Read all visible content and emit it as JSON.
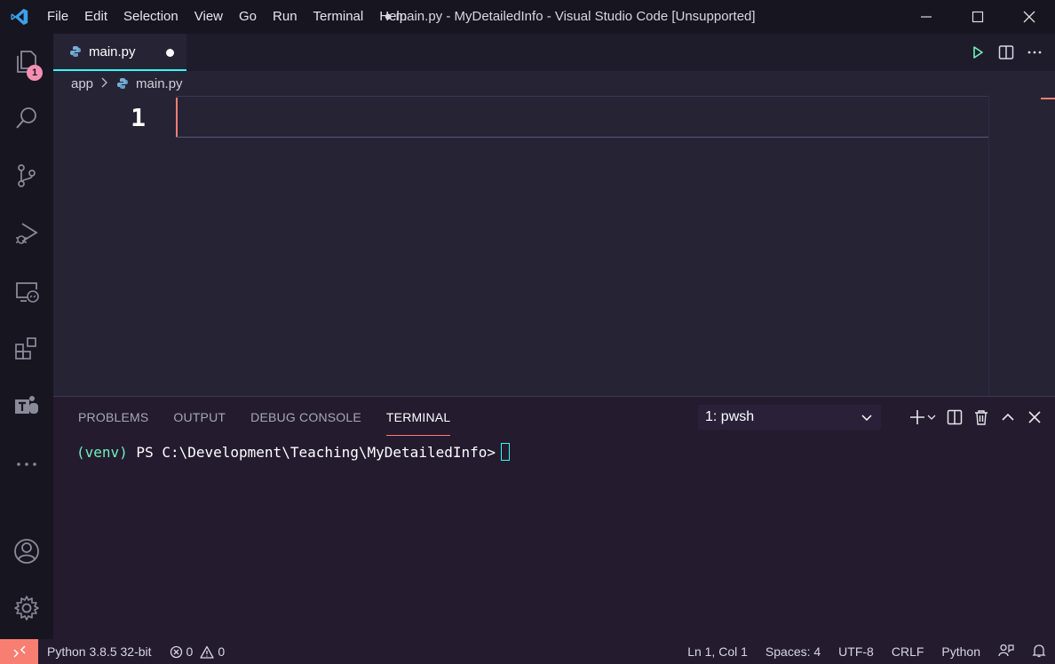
{
  "window": {
    "title": "● main.py - MyDetailedInfo - Visual Studio Code [Unsupported]",
    "menu": [
      "File",
      "Edit",
      "Selection",
      "View",
      "Go",
      "Run",
      "Terminal",
      "Help"
    ]
  },
  "activity_bar": {
    "explorer_badge": "1",
    "items": [
      "explorer-icon",
      "search-icon",
      "source-control-icon",
      "run-debug-icon",
      "remote-explorer-icon",
      "extensions-icon",
      "teams-icon",
      "more-icon"
    ],
    "bottom": [
      "account-icon",
      "gear-icon"
    ]
  },
  "tabs": [
    {
      "label": "main.py",
      "modified": true,
      "active": true
    }
  ],
  "breadcrumb": {
    "folder": "app",
    "file": "main.py"
  },
  "editor": {
    "line_numbers": [
      "1"
    ],
    "content": ""
  },
  "panel": {
    "tabs": [
      "PROBLEMS",
      "OUTPUT",
      "DEBUG CONSOLE",
      "TERMINAL"
    ],
    "active_tab": "TERMINAL",
    "terminal_select": "1: pwsh",
    "terminal": {
      "venv": "(venv)",
      "prompt": " PS C:\\Development\\Teaching\\MyDetailedInfo>"
    }
  },
  "status_bar": {
    "python": "Python 3.8.5 32-bit",
    "errors": "0",
    "warnings": "0",
    "position": "Ln 1, Col 1",
    "spaces": "Spaces: 4",
    "encoding": "UTF-8",
    "eol": "CRLF",
    "language": "Python"
  },
  "colors": {
    "accent_cyan": "#36f9f6",
    "accent_coral": "#f97e72",
    "accent_pink": "#f48fb1",
    "accent_green": "#72f1b8",
    "editor_bg": "#262335",
    "chrome_bg": "#171520"
  }
}
